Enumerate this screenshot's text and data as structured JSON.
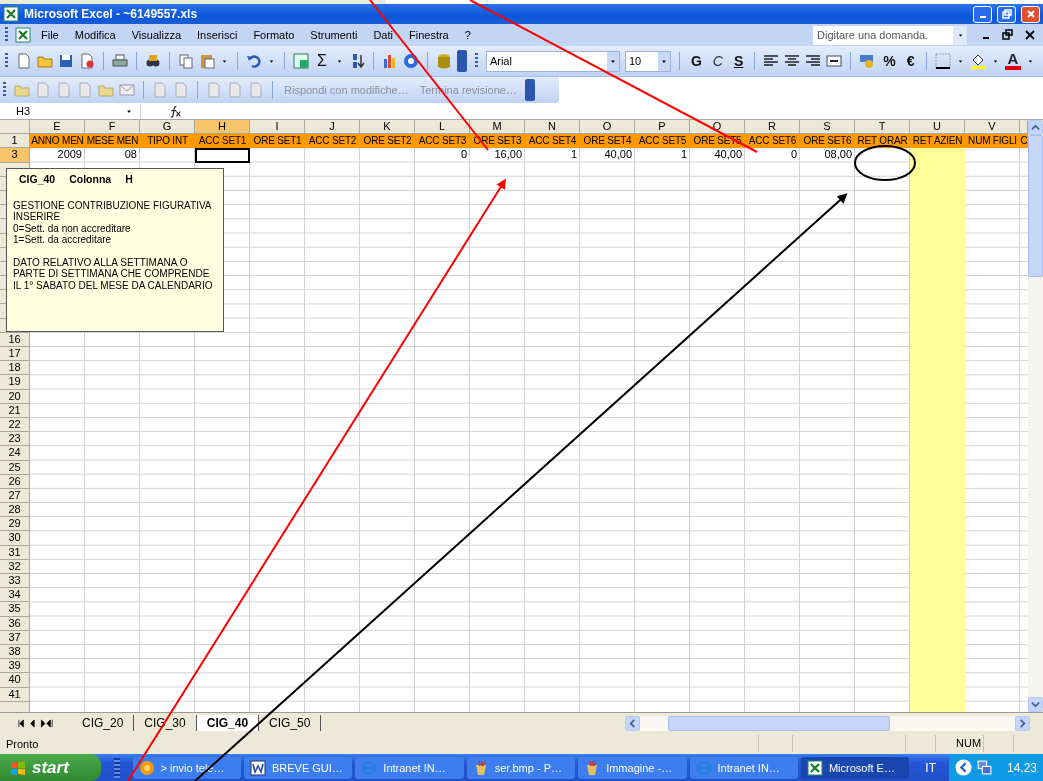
{
  "window": {
    "title": "Microsoft Excel - ~6149557.xls"
  },
  "menu": [
    "File",
    "Modifica",
    "Visualizza",
    "Inserisci",
    "Formato",
    "Strumenti",
    "Dati",
    "Finestra",
    "?"
  ],
  "ask_box": {
    "placeholder": "Digitare una domanda."
  },
  "toolbar": {
    "sum_button": "Σ",
    "font": "Arial",
    "size": "10",
    "bold": "G",
    "italic": "C",
    "underline": "S",
    "percent": "%",
    "euro": "€",
    "font_color": "A"
  },
  "review_toolbar": [
    "Rispondi con modifiche…",
    "Termina revisione…"
  ],
  "formula_bar": {
    "name_box": "H3"
  },
  "columns": [
    {
      "letter": "E",
      "selected": false
    },
    {
      "letter": "F",
      "selected": false
    },
    {
      "letter": "G",
      "selected": false
    },
    {
      "letter": "H",
      "selected": true
    },
    {
      "letter": "I",
      "selected": false
    },
    {
      "letter": "J",
      "selected": false
    },
    {
      "letter": "K",
      "selected": false
    },
    {
      "letter": "L",
      "selected": false
    },
    {
      "letter": "M",
      "selected": false
    },
    {
      "letter": "N",
      "selected": false
    },
    {
      "letter": "O",
      "selected": false
    },
    {
      "letter": "P",
      "selected": false
    },
    {
      "letter": "Q",
      "selected": false
    },
    {
      "letter": "R",
      "selected": false
    },
    {
      "letter": "S",
      "selected": false
    },
    {
      "letter": "T",
      "selected": false
    },
    {
      "letter": "U",
      "selected": false,
      "color": "#ffff99"
    },
    {
      "letter": "V",
      "selected": false
    }
  ],
  "rows": [
    {
      "number": "1",
      "selected": false,
      "kind": "header",
      "cells": [
        "ANNO MEN",
        "MESE MEN",
        "TIPO INT",
        "ACC SET1",
        "ORE SET1",
        "ACC SET2",
        "ORE SET2",
        "ACC SET3",
        "ORE SET3",
        "ACC SET4",
        "ORE SET4",
        "ACC SET5",
        "ORE SET5",
        "ACC SET6",
        "ORE SET6",
        "RET ORAR",
        "RET AZIEN",
        "NUM FIGLI",
        "C"
      ]
    },
    {
      "number": "3",
      "selected": true,
      "kind": "data",
      "cells": [
        "2009",
        "08",
        null,
        null,
        null,
        null,
        null,
        "0",
        "16,00",
        "1",
        "40,00",
        "1",
        "40,00",
        "0",
        "08,00",
        null,
        null,
        null,
        null
      ]
    }
  ],
  "blank_rows": [
    "16",
    "17",
    "18",
    "19",
    "20",
    "21",
    "22",
    "23",
    "24",
    "25",
    "26",
    "27",
    "28",
    "29",
    "30",
    "31",
    "32",
    "33",
    "34",
    "35",
    "36",
    "37",
    "38",
    "39",
    "40",
    "41"
  ],
  "comment": {
    "title": [
      "CIG_40",
      "Colonna",
      "H"
    ],
    "groups": [
      [
        "GESTIONE CONTRIBUZIONE FIGURATIVA",
        "INSERIRE",
        "0=Sett. da non accreditare",
        "1=Sett. da accreditare"
      ],
      [
        "DATO RELATIVO ALLA SETTIMANA  O",
        "PARTE DI SETTIMANA CHE COMPRENDE",
        "IL 1° SABATO DEL MESE  DA CALENDARIO"
      ]
    ]
  },
  "sheet_tabs": [
    {
      "label": "CIG_20",
      "selected": false
    },
    {
      "label": "CIG_30",
      "selected": false
    },
    {
      "label": "CIG_40",
      "selected": true
    },
    {
      "label": "CIG_50",
      "selected": false
    }
  ],
  "status_bar": {
    "text": "Pronto",
    "indicator": "NUM"
  },
  "taskbar": {
    "start": "start",
    "tasks": [
      {
        "label": "> invio tele…",
        "selected": false
      },
      {
        "label": "BREVE GUI…",
        "selected": false
      },
      {
        "label": "Intranet IN…",
        "selected": false
      },
      {
        "label": "ser.bmp - P…",
        "selected": false
      },
      {
        "label": "Immagine -…",
        "selected": false
      },
      {
        "label": "Intranet IN…",
        "selected": false
      },
      {
        "label": "Microsoft E…",
        "selected": true
      }
    ],
    "language": "IT",
    "clock": "14.23"
  },
  "annotations": [
    {
      "kind": "line",
      "color": "#ff0000"
    },
    {
      "kind": "line",
      "color": "#ff0000"
    },
    {
      "kind": "arrow",
      "color": "#ff0000"
    },
    {
      "kind": "arrow",
      "color": "#000000"
    },
    {
      "kind": "ellipse",
      "color": "#000000"
    }
  ]
}
